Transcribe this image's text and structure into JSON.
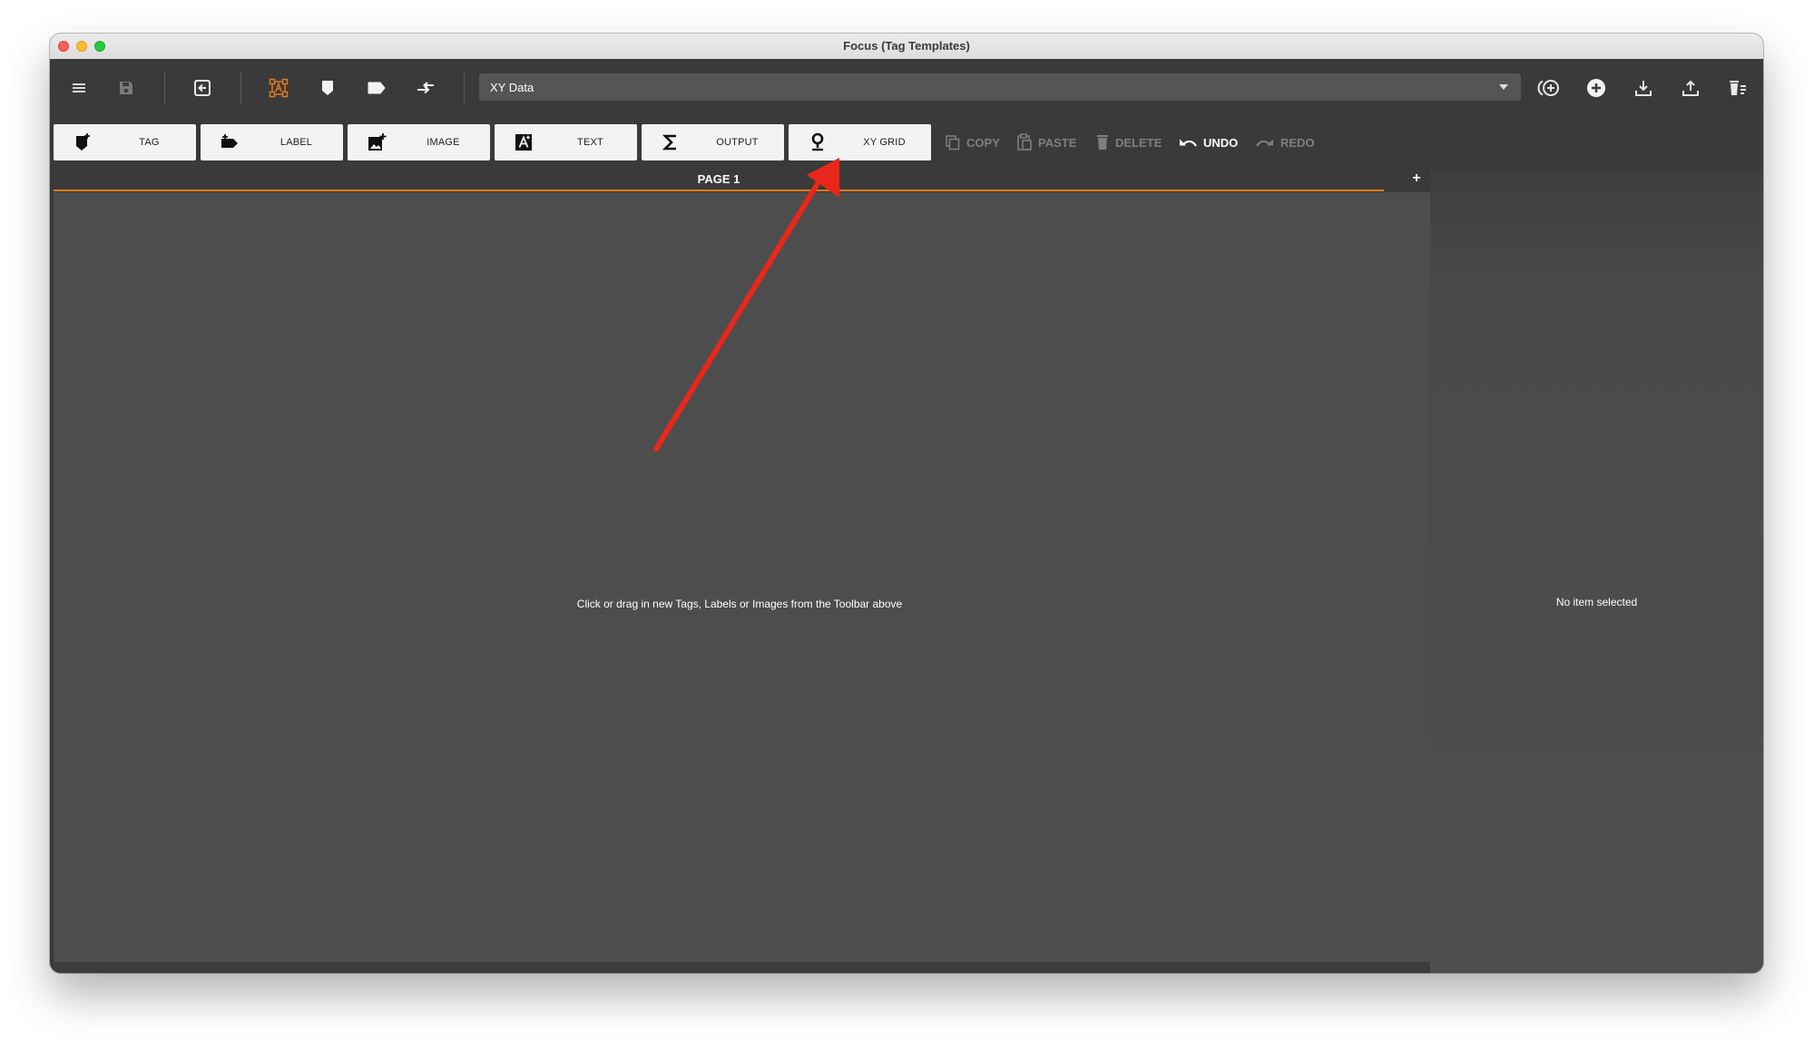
{
  "window": {
    "title": "Focus (Tag Templates)"
  },
  "toolbar": {
    "icons": [
      "menu-icon",
      "save-icon",
      "import-icon",
      "select-icon",
      "tag-icon",
      "label-icon",
      "switch-icon"
    ],
    "template_select": {
      "value": "XY Data"
    },
    "right_icons": [
      "add-circle-outline-icon",
      "add-circle-icon",
      "download-icon",
      "upload-icon",
      "delete-template-icon"
    ]
  },
  "insert_bar": {
    "items": [
      {
        "label": "TAG",
        "icon": "tag-plus-icon"
      },
      {
        "label": "LABEL",
        "icon": "label-plus-icon"
      },
      {
        "label": "IMAGE",
        "icon": "image-plus-icon"
      },
      {
        "label": "TEXT",
        "icon": "text-box-icon"
      },
      {
        "label": "OUTPUT",
        "icon": "sigma-icon"
      },
      {
        "label": "XY GRID",
        "icon": "map-pin-icon"
      }
    ]
  },
  "edit_bar": {
    "copy": "COPY",
    "paste": "PASTE",
    "delete": "DELETE",
    "undo": "UNDO",
    "redo": "REDO"
  },
  "pages": {
    "active": "PAGE 1",
    "add": "+"
  },
  "canvas": {
    "hint": "Click or drag in new Tags, Labels or Images from the Toolbar above"
  },
  "inspector": {
    "empty": "No item selected"
  },
  "colors": {
    "accent": "#e07a1f",
    "annotation_arrow": "#e8271a",
    "canvas": "#4d4d4d",
    "chrome": "#3a3a3a"
  }
}
